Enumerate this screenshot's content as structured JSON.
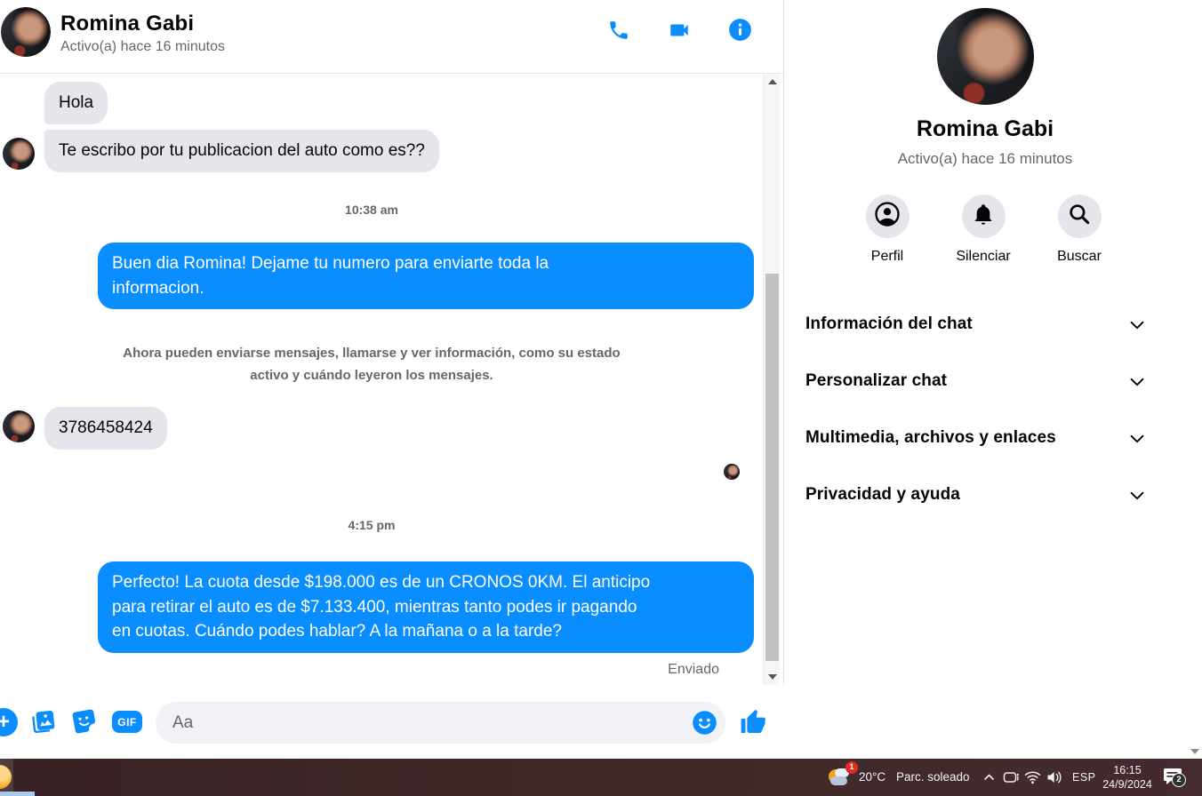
{
  "chat": {
    "header": {
      "name": "Romina Gabi",
      "status": "Activo(a) hace 16 minutos"
    },
    "messages": [
      {
        "type": "received",
        "text": "Hola"
      },
      {
        "type": "received",
        "text": "Te escribo por tu publicacion del auto como es??"
      },
      {
        "type": "timestamp",
        "text": "10:38 am"
      },
      {
        "type": "sent",
        "text": "Buen dia Romina! Dejame tu numero para enviarte toda la\ninformacion."
      },
      {
        "type": "system",
        "text": "Ahora pueden enviarse mensajes, llamarse y ver información, como su estado\nactivo y cuándo leyeron los mensajes."
      },
      {
        "type": "received",
        "text": "3786458424"
      },
      {
        "type": "timestamp",
        "text": "4:15 pm"
      },
      {
        "type": "sent",
        "text": "Perfecto! La cuota desde $198.000 es de un CRONOS 0KM. El anticipo\npara retirar el auto es de $7.133.400, mientras tanto podes ir pagando\nen cuotas. Cuándo podes hablar? A la mañana o a la tarde?"
      },
      {
        "type": "status",
        "text": "Enviado"
      }
    ],
    "composer": {
      "placeholder": "Aa",
      "gif_label": "GIF"
    }
  },
  "sidebar": {
    "profile": {
      "name": "Romina Gabi",
      "status": "Activo(a) hace 16 minutos"
    },
    "actions": [
      {
        "label": "Perfil"
      },
      {
        "label": "Silenciar"
      },
      {
        "label": "Buscar"
      }
    ],
    "sections": [
      {
        "label": "Información del chat"
      },
      {
        "label": "Personalizar chat"
      },
      {
        "label": "Multimedia, archivos y enlaces"
      },
      {
        "label": "Privacidad y ayuda"
      }
    ]
  },
  "taskbar": {
    "weather_badge": "1",
    "temperature": "20°C",
    "condition": "Parc. soleado",
    "language": "ESP",
    "time": "16:15",
    "date": "24/9/2024",
    "notification_count": "2"
  },
  "colors": {
    "accent": "#0a8dff",
    "bubble_gray": "#e4e6eb",
    "muted_text": "#65676b",
    "taskbar_bg": "#3d2727"
  }
}
